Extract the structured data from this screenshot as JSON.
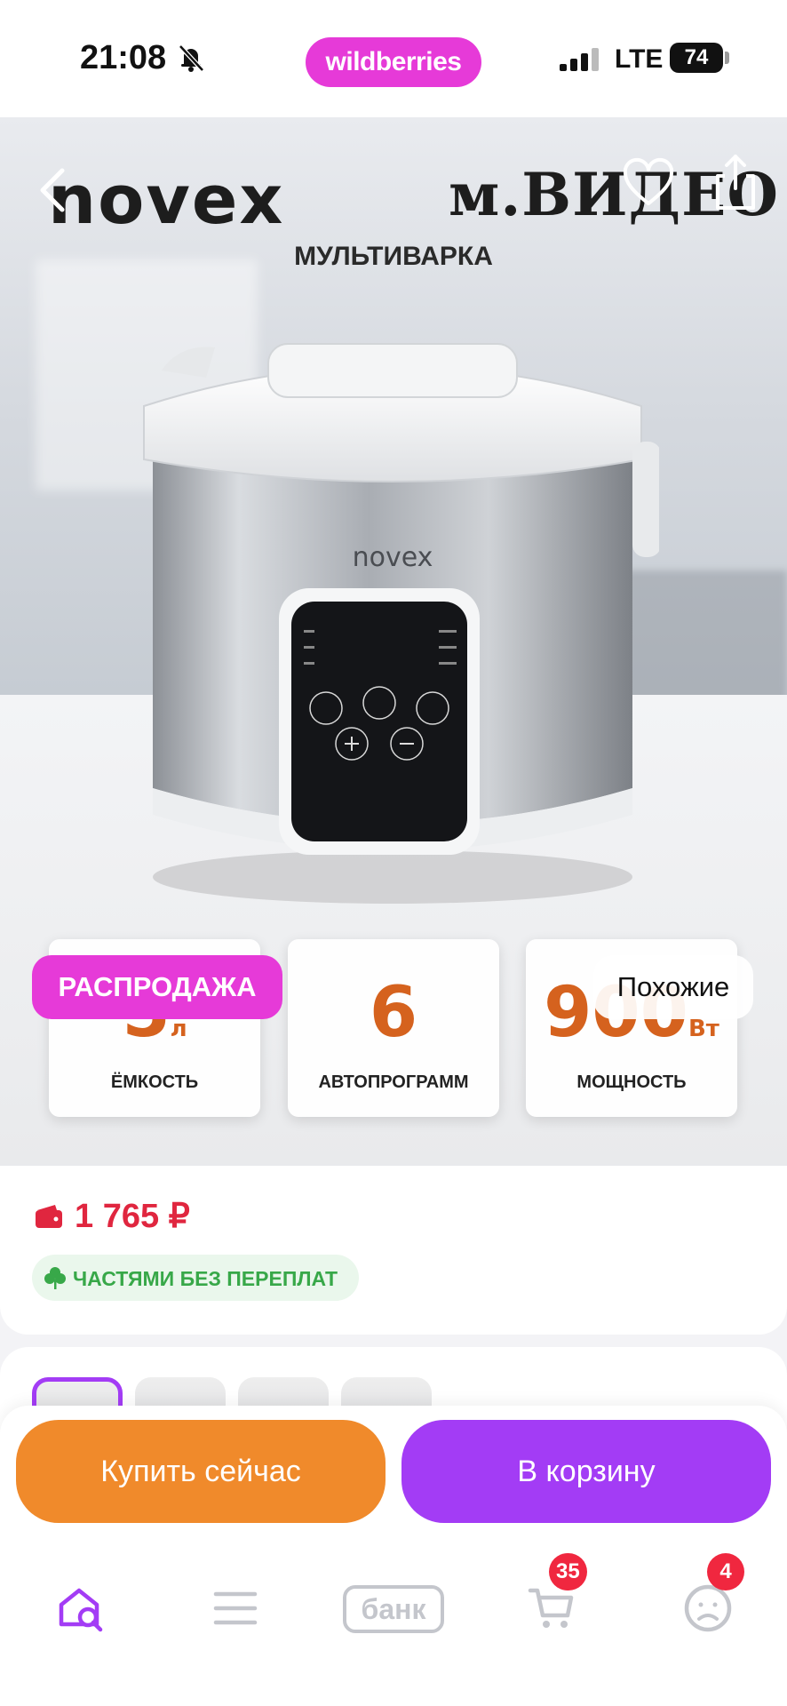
{
  "status_bar": {
    "time": "21:08",
    "network": "LTE",
    "battery": "74",
    "app_badge": "wildberries"
  },
  "hero": {
    "brand_left": "novex",
    "brand_right": "м.ВИДЕО",
    "product_type": "МУЛЬТИВАРКА",
    "cooker_logo": "novex",
    "specs": [
      {
        "value": "5",
        "unit": "л",
        "label": "ЁМКОСТЬ"
      },
      {
        "value": "6",
        "unit": "",
        "label": "АВТОПРОГРАММ"
      },
      {
        "value": "900",
        "unit": "Вт",
        "label": "МОЩНОСТЬ"
      }
    ],
    "sale_badge": "РАСПРОДАЖА",
    "similar_button": "Похожие"
  },
  "price": {
    "amount": "1 765 ₽",
    "installment": "ЧАСТЯМИ БЕЗ ПЕРЕПЛАТ"
  },
  "actions": {
    "buy_now": "Купить сейчас",
    "add_to_cart": "В корзину"
  },
  "nav": {
    "bank_label": "банк",
    "cart_count": "35",
    "profile_count": "4"
  },
  "colors": {
    "brand": "#e63ad8",
    "accent": "#a33cf5",
    "buy": "#f08a2b",
    "price": "#e0263f",
    "spec_value": "#d5621e",
    "installment": "#38a849"
  },
  "icons": [
    "bell-slash-icon",
    "signal-icon",
    "back-icon",
    "heart-icon",
    "share-icon",
    "wallet-icon",
    "clover-icon",
    "home-search-icon",
    "menu-icon",
    "bank-icon",
    "cart-icon",
    "profile-icon"
  ]
}
